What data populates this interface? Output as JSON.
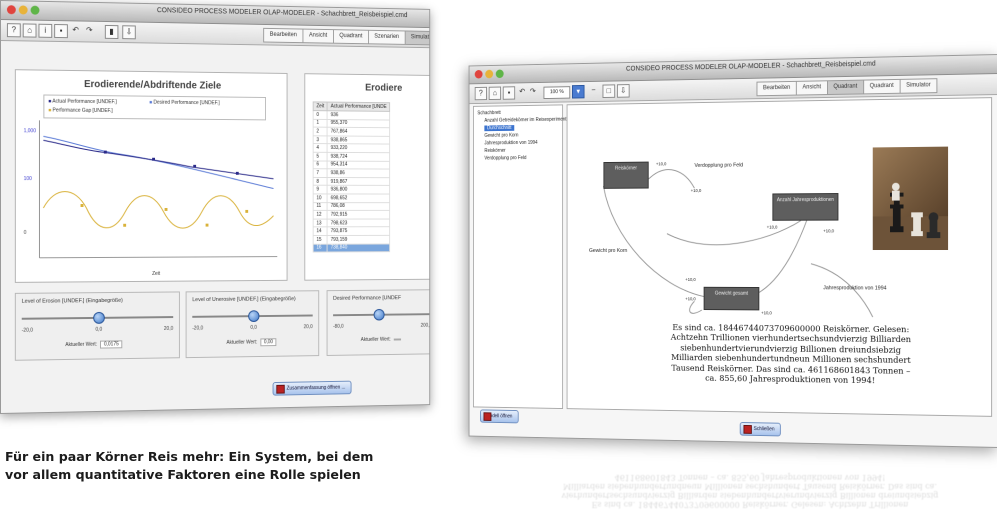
{
  "window1": {
    "title": "CONSIDEO PROCESS MODELER OLAP-MODELER - Schachbrett_Reisbeispiel.cmd",
    "tabs": [
      "Bearbeiten",
      "Ansicht",
      "Quadrant",
      "Szenarien",
      "Simulator"
    ],
    "active_tab": 4,
    "chart": {
      "title": "Erodierende/Abdriftende Ziele",
      "legend": [
        "Actual Performance [UNDEF.]",
        "Desired Performance [UNDEF.]",
        "Performance Gap [UNDEF.]"
      ],
      "xlabel": "Zeit",
      "colors": {
        "actual": "#2b2b8a",
        "desired": "#5b7bd6",
        "gap": "#d9b23a"
      }
    },
    "table": {
      "title": "Erodiere",
      "columns": [
        "Zeit",
        "Actual Performance [UNDE"
      ],
      "rows": [
        [
          "0",
          "936"
        ],
        [
          "1",
          "955,370"
        ],
        [
          "2",
          "767,864"
        ],
        [
          "3",
          "938,865"
        ],
        [
          "4",
          "933,220"
        ],
        [
          "5",
          "938,724"
        ],
        [
          "6",
          "954,314"
        ],
        [
          "7",
          "938,86"
        ],
        [
          "8",
          "919,867"
        ],
        [
          "9",
          "936,800"
        ],
        [
          "10",
          "698,652"
        ],
        [
          "11",
          "786,08"
        ],
        [
          "12",
          "792,915"
        ],
        [
          "13",
          "798,623"
        ],
        [
          "14",
          "793,875"
        ],
        [
          "15",
          "793,159"
        ],
        [
          "16",
          "738,840"
        ]
      ]
    },
    "sliders": [
      {
        "label": "Level of Erosion [UNDEF.] (Eingabegröße)",
        "ticks": [
          "-20,0",
          "0,0",
          "20,0"
        ],
        "value_label": "Aktueller Wert:",
        "value": "0,0175",
        "knob": 0.5
      },
      {
        "label": "Level of Unerosive [UNDEF.] (Eingabegröße)",
        "ticks": [
          "-20,0",
          "0,0",
          "20,0"
        ],
        "value_label": "Aktueller Wert:",
        "value": "0,00",
        "knob": 0.5
      },
      {
        "label": "Desired Performance [UNDEF",
        "ticks": [
          "-80,0",
          "200,0"
        ],
        "value_label": "Aktueller Wert:",
        "value": "",
        "knob": 0.45
      }
    ],
    "bottom_button": "Zusammenfassung öffnen ..."
  },
  "window2": {
    "title": "CONSIDEO PROCESS MODELER OLAP-MODELER - Schachbrett_Reisbeispiel.cmd",
    "zoom": "100 %",
    "tabs": [
      "Bearbeiten",
      "Ansicht",
      "Quadrant",
      "Quadrant",
      "Simulator"
    ],
    "active_tab": 2,
    "tree": [
      "Schachbrett",
      "Anzahl Getreidekörner im Reisexperiment",
      "Durchschnitt",
      "Gewicht pro Korn",
      "Jahresproduktion von 1994",
      "Reiskörner",
      "Verdopplung pro Feld"
    ],
    "tree_selected": 2,
    "tree_button": "Modell öffnen",
    "nodes": [
      "Reiskörner",
      "Anzahl Jahresproduktionen",
      "Gewicht gesamt"
    ],
    "labels": [
      "Verdopplung pro Feld",
      "Gewicht pro Korn",
      "Jahresproduktion von 1994",
      "+10,0",
      "+10,0",
      "+10,0",
      "+10,0",
      "+10,0",
      "+10,0",
      "+10,0"
    ],
    "result_text": "Es sind ca. 18446744073709600000 Reiskörner. Gelesen: Achtzehn Trillionen vierhundertsechsundvierzig Billiarden siebenhundertvierundvierzig Billionen dreiundsiebzig Milliarden siebenhundertundneun Millionen sechshundert Tausend Reiskörner. Das sind ca. 461168601843 Tonnen – ca. 855,60 Jahresproduktionen von 1994!",
    "bottom_button": "Schließen"
  },
  "caption": {
    "line1": "Für ein paar Körner Reis mehr: Ein System, bei dem",
    "line2": "vor allem quantitative Faktoren eine Rolle spielen"
  }
}
